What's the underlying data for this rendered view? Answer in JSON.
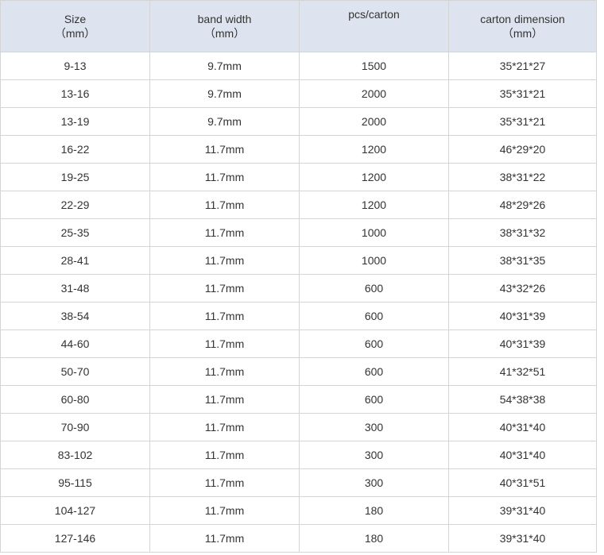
{
  "table": {
    "headers": [
      {
        "line1": "Size",
        "line2": "（mm）"
      },
      {
        "line1": "band width",
        "line2": "（mm）"
      },
      {
        "line1": "pcs/carton",
        "line2": ""
      },
      {
        "line1": "carton dimension",
        "line2": "（mm）"
      }
    ],
    "rows": [
      [
        "9-13",
        "9.7mm",
        "1500",
        "35*21*27"
      ],
      [
        "13-16",
        "9.7mm",
        "2000",
        "35*31*21"
      ],
      [
        "13-19",
        "9.7mm",
        "2000",
        "35*31*21"
      ],
      [
        "16-22",
        "11.7mm",
        "1200",
        "46*29*20"
      ],
      [
        "19-25",
        "11.7mm",
        "1200",
        "38*31*22"
      ],
      [
        "22-29",
        "11.7mm",
        "1200",
        "48*29*26"
      ],
      [
        "25-35",
        "11.7mm",
        "1000",
        "38*31*32"
      ],
      [
        "28-41",
        "11.7mm",
        "1000",
        "38*31*35"
      ],
      [
        "31-48",
        "11.7mm",
        "600",
        "43*32*26"
      ],
      [
        "38-54",
        "11.7mm",
        "600",
        "40*31*39"
      ],
      [
        "44-60",
        "11.7mm",
        "600",
        "40*31*39"
      ],
      [
        "50-70",
        "11.7mm",
        "600",
        "41*32*51"
      ],
      [
        "60-80",
        "11.7mm",
        "600",
        "54*38*38"
      ],
      [
        "70-90",
        "11.7mm",
        "300",
        "40*31*40"
      ],
      [
        "83-102",
        "11.7mm",
        "300",
        "40*31*40"
      ],
      [
        "95-115",
        "11.7mm",
        "300",
        "40*31*51"
      ],
      [
        "104-127",
        "11.7mm",
        "180",
        "39*31*40"
      ],
      [
        "127-146",
        "11.7mm",
        "180",
        "39*31*40"
      ]
    ]
  },
  "colors": {
    "header_background": "#dde4ef",
    "border": "#d4d4d4",
    "text": "#333333"
  }
}
